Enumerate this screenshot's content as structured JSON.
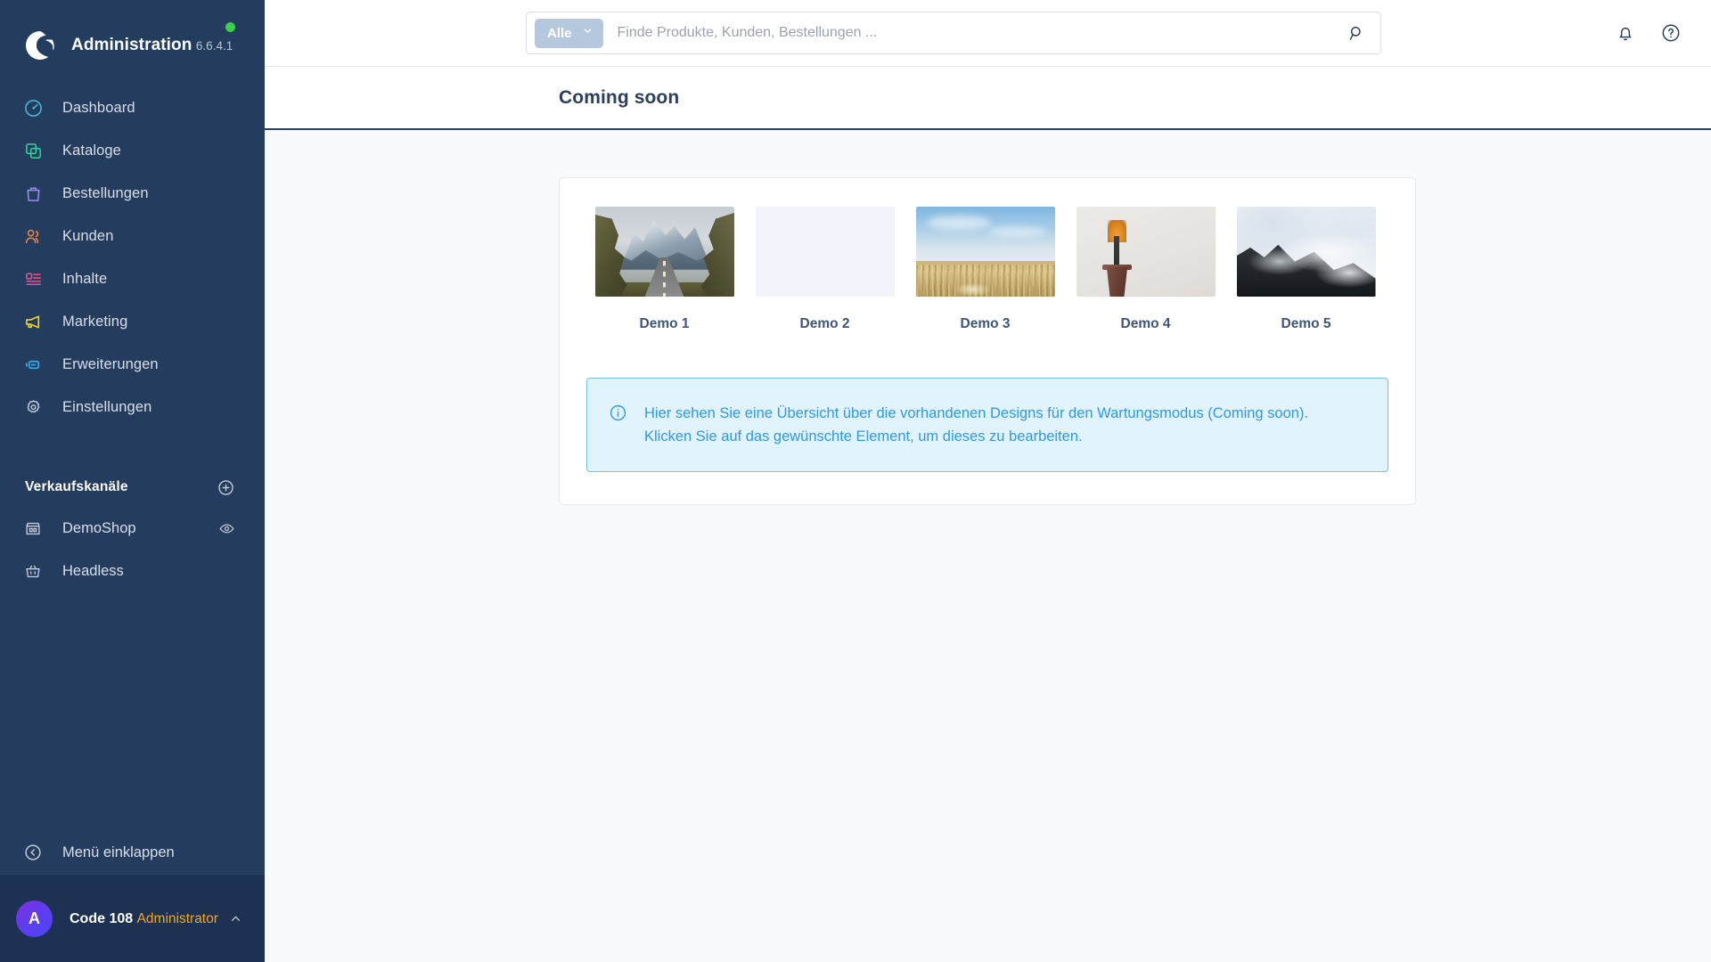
{
  "sidebar": {
    "brand": {
      "title": "Administration",
      "version": "6.6.4.1",
      "logo_icon": "shopware-logo-icon",
      "status_icon": "status-online-dot"
    },
    "nav_items": [
      {
        "label": "Dashboard",
        "icon": "dashboard-gauge-icon",
        "color": "#4bbbd4"
      },
      {
        "label": "Kataloge",
        "icon": "catalog-layers-icon",
        "color": "#37d399"
      },
      {
        "label": "Bestellungen",
        "icon": "orders-bag-icon",
        "color": "#9b8cf0"
      },
      {
        "label": "Kunden",
        "icon": "customers-users-icon",
        "color": "#f2864b"
      },
      {
        "label": "Inhalte",
        "icon": "content-pages-icon",
        "color": "#ef4e8e"
      },
      {
        "label": "Marketing",
        "icon": "marketing-megaphone-icon",
        "color": "#f7d417"
      },
      {
        "label": "Erweiterungen",
        "icon": "extensions-plug-icon",
        "color": "#2bb3f5"
      },
      {
        "label": "Einstellungen",
        "icon": "settings-gear-icon",
        "color": "#c3cbd7"
      }
    ],
    "sales_channels": {
      "section_title": "Verkaufskanäle",
      "add_icon": "plus-circle-icon",
      "items": [
        {
          "label": "DemoShop",
          "icon": "storefront-icon",
          "action_icon": "eye-icon"
        },
        {
          "label": "Headless",
          "icon": "basket-icon",
          "action_icon": ""
        }
      ]
    },
    "collapse": {
      "label": "Menü einklappen",
      "icon": "chevron-left-circle-icon"
    },
    "user": {
      "initial": "A",
      "name": "Code 108",
      "role": "Administrator",
      "chevron_icon": "chevron-up-icon"
    }
  },
  "topbar": {
    "search": {
      "scope_label": "Alle",
      "scope_chevron_icon": "chevron-down-icon",
      "placeholder": "Finde Produkte, Kunden, Bestellungen ...",
      "value": "",
      "search_icon": "search-icon"
    },
    "actions": [
      {
        "name": "notifications",
        "icon": "bell-icon"
      },
      {
        "name": "help",
        "icon": "question-circle-icon"
      }
    ]
  },
  "page": {
    "title": "Coming soon"
  },
  "designs": [
    {
      "label": "Demo 1",
      "scene": "mountain-road"
    },
    {
      "label": "Demo 2",
      "scene": "empty-placeholder"
    },
    {
      "label": "Demo 3",
      "scene": "dune-grass-sky"
    },
    {
      "label": "Demo 4",
      "scene": "potted-plant"
    },
    {
      "label": "Demo 5",
      "scene": "foggy-mountain"
    }
  ],
  "alert": {
    "icon": "info-circle-icon",
    "line1": "Hier sehen Sie eine Übersicht über die vorhandenen Designs für den Wartungsmodus (Coming soon).",
    "line2": "Klicken Sie auf das gewünschte Element, um dieses zu bearbeiten."
  },
  "colors": {
    "sidebar_bg": "#243c5e",
    "sidebar_user_bg": "#1d3152",
    "accent_role": "#f5a623",
    "status_online": "#37d046",
    "page_bg": "#f8f9fb",
    "title_text": "#2b3f5f",
    "alert_bg": "#e1f3fd",
    "alert_border": "#6ec0f0",
    "alert_text": "#2b9ae8"
  }
}
